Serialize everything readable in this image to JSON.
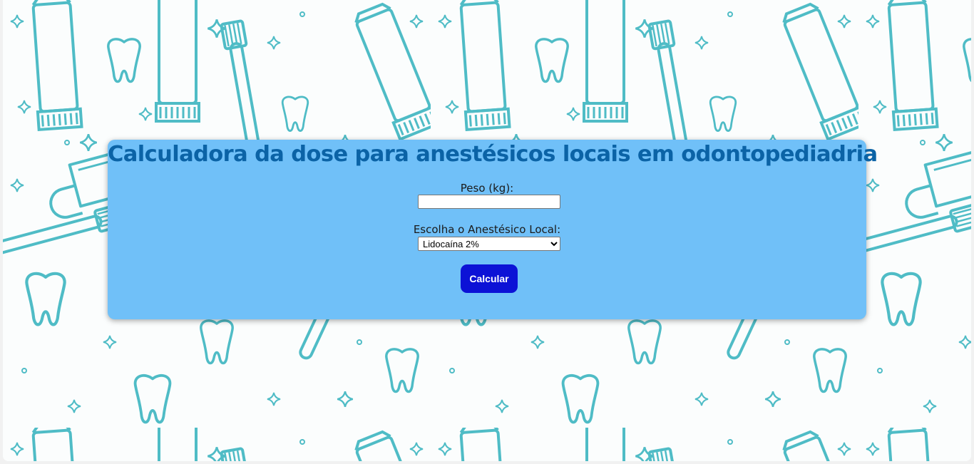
{
  "page": {
    "title": "Calculadora da dose para anestésicos locais em odontopediadria"
  },
  "form": {
    "weight": {
      "label": "Peso (kg):",
      "value": "",
      "placeholder": ""
    },
    "anesthetic": {
      "label": "Escolha o Anestésico Local:",
      "selected": "Lidocaína 2%"
    },
    "submit_label": "Calcular"
  },
  "background": {
    "pattern": "dental-doodles",
    "icons": [
      "tooth-icon",
      "toothpaste-tube-icon",
      "toothbrush-icon",
      "dental-floss-icon",
      "sparkle-icon"
    ]
  },
  "colors": {
    "pattern_stroke": "#4fbcc6",
    "background": "#fbfdfd",
    "card_background": "#70c0f8",
    "title": "#0b63a6",
    "button": "#0c12d6",
    "button_text": "#ffffff"
  }
}
